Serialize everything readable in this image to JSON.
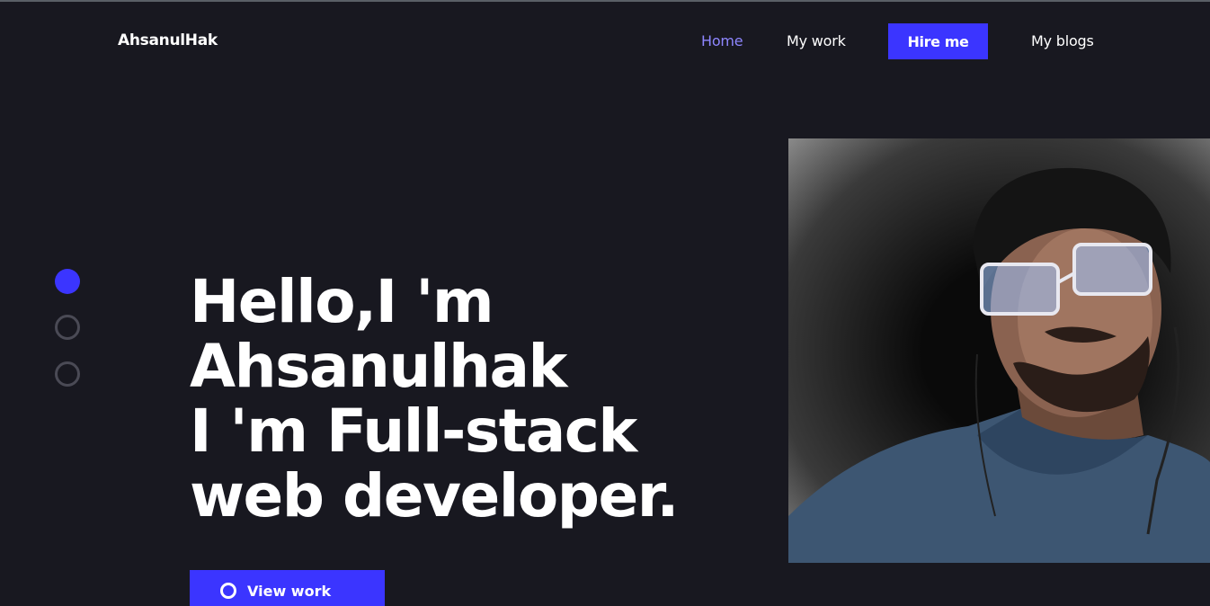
{
  "nav": {
    "brand": "AhsanulHak",
    "links": [
      {
        "label": "Home",
        "active": true
      },
      {
        "label": "My work",
        "active": false
      },
      {
        "label": "Hire me",
        "active": false
      },
      {
        "label": "My blogs",
        "active": false
      }
    ]
  },
  "hero": {
    "title_lines": [
      "Hello,I 'm",
      "Ahsanulhak",
      "I 'm Full-stack",
      "web developer."
    ],
    "cta_label": "View work",
    "cta_icon": "play-circle-icon"
  },
  "slider": {
    "dots": [
      {
        "state": "active"
      },
      {
        "state": "inactive"
      },
      {
        "state": "inactive"
      }
    ]
  },
  "colors": {
    "background": "#181820",
    "accent": "#3b35ff",
    "active_link": "#8e86ff",
    "text": "#ffffff"
  }
}
